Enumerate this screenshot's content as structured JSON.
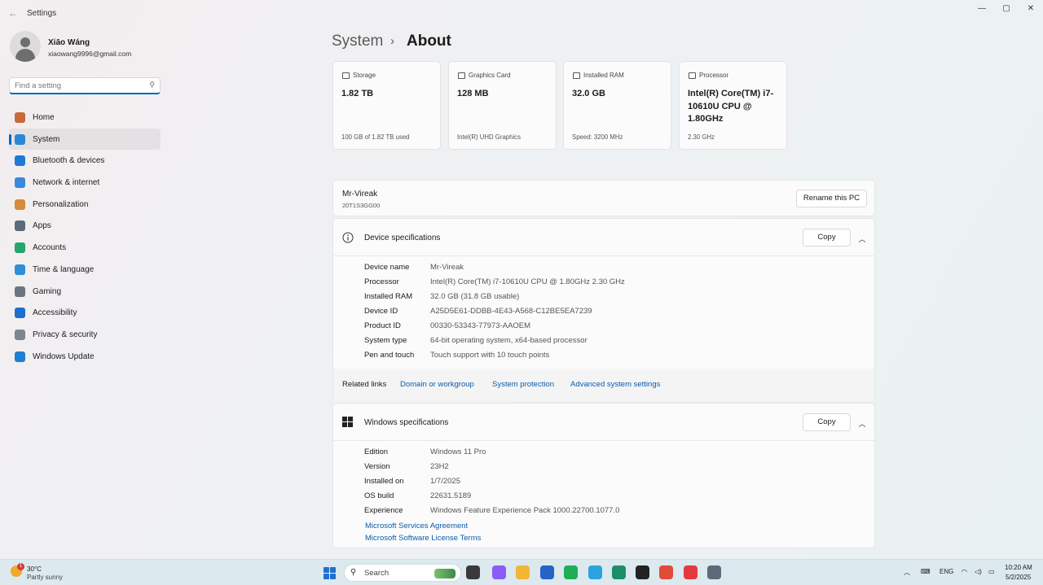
{
  "window": {
    "title": "Settings",
    "back_icon": "back-arrow-icon",
    "controls": [
      "minimize-icon",
      "maximize-icon",
      "close-icon"
    ]
  },
  "user": {
    "name": "Xiāo Wáng",
    "email": "xiaowang9996@gmail.com"
  },
  "search": {
    "placeholder": "Find a setting"
  },
  "sidebar": {
    "items": [
      {
        "label": "Home",
        "icon": "home-icon",
        "color": "#c96a3a"
      },
      {
        "label": "System",
        "icon": "monitor-icon",
        "color": "#2a87d8",
        "active": true
      },
      {
        "label": "Bluetooth & devices",
        "icon": "bluetooth-icon",
        "color": "#1f7ad4"
      },
      {
        "label": "Network & internet",
        "icon": "wifi-icon",
        "color": "#3b8ad9"
      },
      {
        "label": "Personalization",
        "icon": "brush-icon",
        "color": "#d58a3c"
      },
      {
        "label": "Apps",
        "icon": "apps-icon",
        "color": "#5d6a77"
      },
      {
        "label": "Accounts",
        "icon": "person-icon",
        "color": "#27a36c"
      },
      {
        "label": "Time & language",
        "icon": "globe-clock-icon",
        "color": "#2d8fd6"
      },
      {
        "label": "Gaming",
        "icon": "gamepad-icon",
        "color": "#6b7480"
      },
      {
        "label": "Accessibility",
        "icon": "accessibility-icon",
        "color": "#1d6fc9"
      },
      {
        "label": "Privacy & security",
        "icon": "shield-icon",
        "color": "#7d8790"
      },
      {
        "label": "Windows Update",
        "icon": "update-icon",
        "color": "#1f7fd2"
      }
    ]
  },
  "breadcrumb": {
    "parent": "System",
    "separator": "›",
    "current": "About"
  },
  "cards": [
    {
      "label": "Storage",
      "value": "1.82 TB",
      "sub": "100 GB of 1.82 TB used",
      "icon": "storage-icon"
    },
    {
      "label": "Graphics Card",
      "value": "128 MB",
      "sub": "Intel(R) UHD Graphics",
      "icon": "graphics-card-icon"
    },
    {
      "label": "Installed RAM",
      "value": "32.0 GB",
      "sub": "Speed: 3200 MHz",
      "icon": "ram-icon"
    },
    {
      "label": "Processor",
      "value": "Intel(R) Core(TM) i7-10610U CPU @ 1.80GHz",
      "sub": "2.30 GHz",
      "icon": "processor-icon"
    }
  ],
  "pc": {
    "name": "Mr-Vireak",
    "model": "20T1S3GG00",
    "rename_label": "Rename this PC"
  },
  "device_specs": {
    "title": "Device specifications",
    "copy_label": "Copy",
    "icon": "info-icon",
    "rows": [
      {
        "k": "Device name",
        "v": "Mr-Vireak"
      },
      {
        "k": "Processor",
        "v": "Intel(R) Core(TM) i7-10610U CPU @ 1.80GHz   2.30 GHz"
      },
      {
        "k": "Installed RAM",
        "v": "32.0 GB (31.8 GB usable)"
      },
      {
        "k": "Device ID",
        "v": "A25D5E61-DDBB-4E43-A568-C12BE5EA7239"
      },
      {
        "k": "Product ID",
        "v": "00330-53343-77973-AAOEM"
      },
      {
        "k": "System type",
        "v": "64-bit operating system, x64-based processor"
      },
      {
        "k": "Pen and touch",
        "v": "Touch support with 10 touch points"
      }
    ]
  },
  "related_links": {
    "label": "Related links",
    "links": [
      "Domain or workgroup",
      "System protection",
      "Advanced system settings"
    ]
  },
  "windows_specs": {
    "title": "Windows specifications",
    "copy_label": "Copy",
    "icon": "windows-logo-icon",
    "rows": [
      {
        "k": "Edition",
        "v": "Windows 11 Pro"
      },
      {
        "k": "Version",
        "v": "23H2"
      },
      {
        "k": "Installed on",
        "v": "1/7/2025"
      },
      {
        "k": "OS build",
        "v": "22631.5189"
      },
      {
        "k": "Experience",
        "v": "Windows Feature Experience Pack 1000.22700.1077.0"
      }
    ],
    "links": [
      "Microsoft Services Agreement",
      "Microsoft Software License Terms"
    ]
  },
  "taskbar": {
    "weather_temp": "30°C",
    "weather_cond": "Partly sunny",
    "weather_badge": "1",
    "search_label": "Search",
    "apps": [
      {
        "name": "file-manager-icon",
        "color": "#3a3a3a"
      },
      {
        "name": "copilot-icon",
        "color": "#8b5cf6"
      },
      {
        "name": "file-explorer-icon",
        "color": "#f2b632"
      },
      {
        "name": "store-icon",
        "color": "#2364c5"
      },
      {
        "name": "whatsapp-icon",
        "color": "#1fae55"
      },
      {
        "name": "telegram-icon",
        "color": "#2aa3e0"
      },
      {
        "name": "edge-icon",
        "color": "#1a8f6a"
      },
      {
        "name": "capcut-icon",
        "color": "#222222"
      },
      {
        "name": "chrome-icon",
        "color": "#e04b3a"
      },
      {
        "name": "wps-icon",
        "color": "#e2393f"
      },
      {
        "name": "settings-gear-icon",
        "color": "#5b6b7a"
      }
    ],
    "tray": {
      "lang": "ENG",
      "time": "10:20 AM",
      "date": "5/2/2025"
    }
  }
}
